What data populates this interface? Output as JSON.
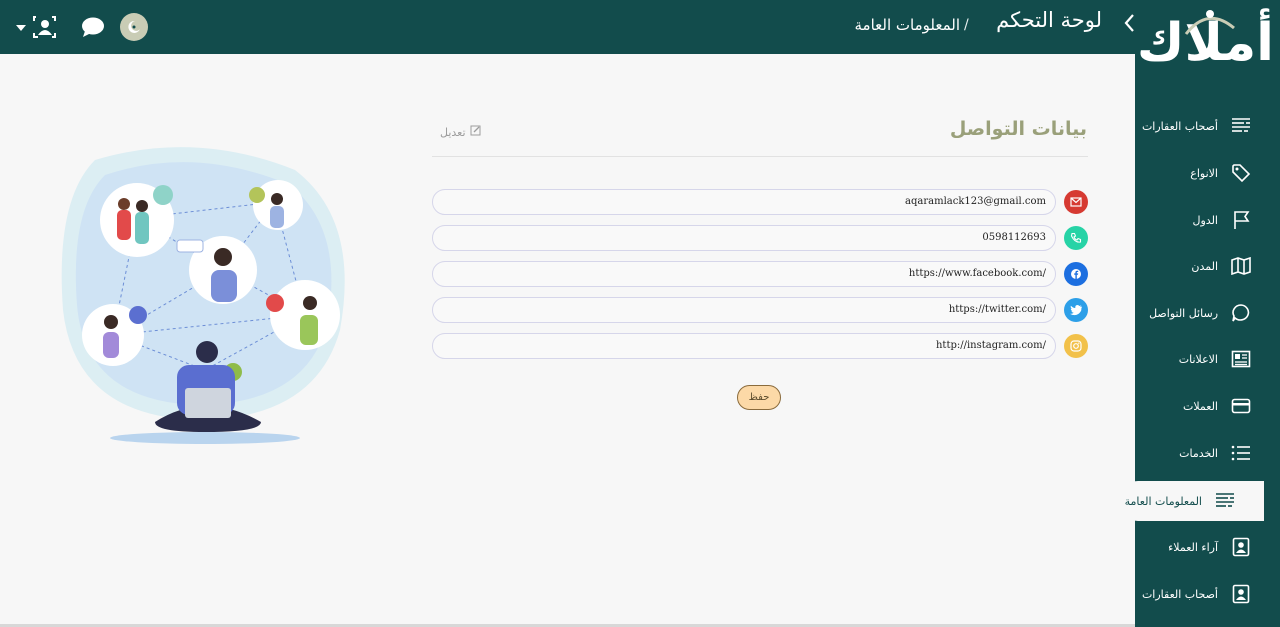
{
  "header": {
    "breadcrumb_title": "لوحة التحكم",
    "breadcrumb_separator": "/",
    "breadcrumb_current": "المعلومات العامة",
    "icons": [
      "user-frame-icon",
      "chat-bubble-icon",
      "avatar-icon"
    ]
  },
  "logo": {
    "text": "أملاك"
  },
  "sidebar": {
    "items": [
      {
        "label": "أصحاب العقارات",
        "icon": "list-lines-icon"
      },
      {
        "label": "الانواع",
        "icon": "tag-icon"
      },
      {
        "label": "الدول",
        "icon": "flag-icon"
      },
      {
        "label": "المدن",
        "icon": "map-icon"
      },
      {
        "label": "رسائل التواصل",
        "icon": "speech-bubble-icon"
      },
      {
        "label": "الاعلانات",
        "icon": "newspaper-icon"
      },
      {
        "label": "العملات",
        "icon": "credit-card-icon"
      },
      {
        "label": "الخدمات",
        "icon": "list-icon"
      },
      {
        "label": "المعلومات العامة",
        "icon": "list-lines-icon",
        "active": true
      },
      {
        "label": "آراء العملاء",
        "icon": "contact-card-icon"
      },
      {
        "label": "أصحاب العقارات",
        "icon": "contact-card-icon"
      }
    ]
  },
  "main": {
    "title": "بيانات التواصل",
    "edit_label": "تعديل",
    "fields": [
      {
        "type": "email",
        "value": "aqaramlack123@gmail.com",
        "icon": "envelope-icon",
        "color": "#d63a32"
      },
      {
        "type": "phone",
        "value": "0598112693",
        "icon": "phone-icon",
        "color": "#27d3a6"
      },
      {
        "type": "facebook",
        "value": "https://www.facebook.com/",
        "icon": "facebook-icon",
        "color": "#1d6fe0"
      },
      {
        "type": "twitter",
        "value": "https://twitter.com/",
        "icon": "twitter-icon",
        "color": "#2d9fe8"
      },
      {
        "type": "instagram",
        "value": "http://instagram.com/",
        "icon": "instagram-icon",
        "color": "#f2c14a"
      }
    ],
    "save_label": "حفظ"
  },
  "colors": {
    "primary": "#124c4c",
    "background": "#f7f7f7",
    "title": "#9aa07a",
    "save_button": "#fcd9a7"
  }
}
